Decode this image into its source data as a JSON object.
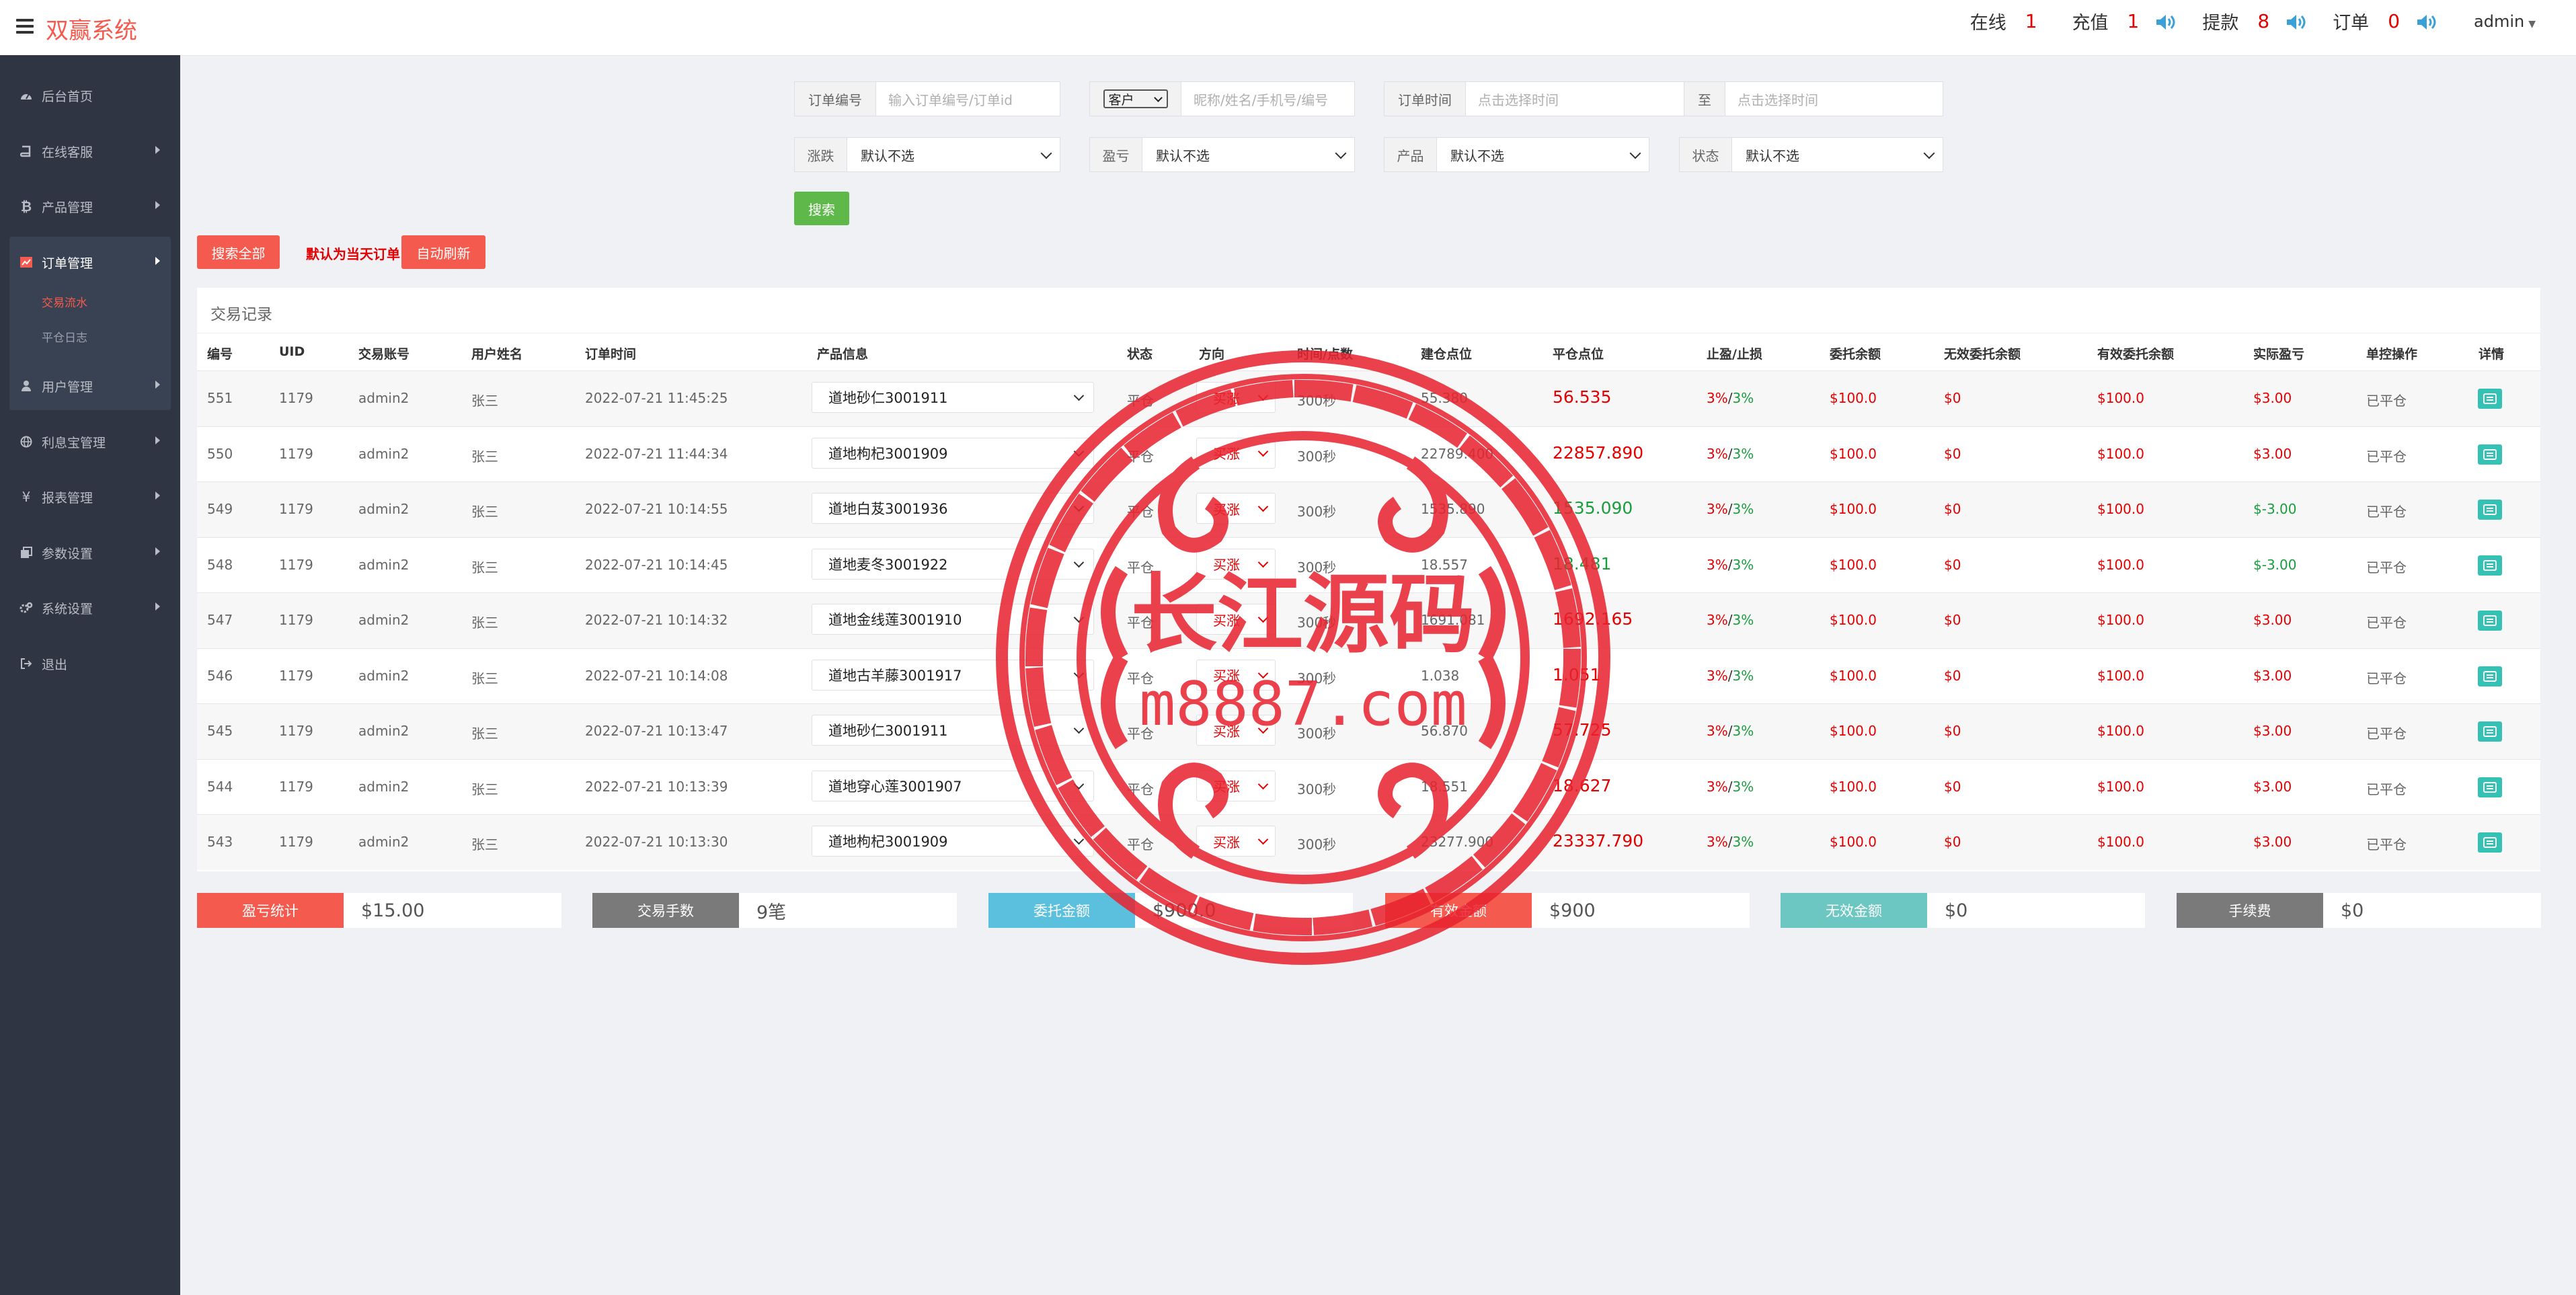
{
  "app": {
    "title": "双赢系统"
  },
  "topbar": {
    "online_label": "在线",
    "online_count": "1",
    "recharge_label": "充值",
    "recharge_count": "1",
    "withdraw_label": "提款",
    "withdraw_count": "8",
    "order_label": "订单",
    "order_count": "0",
    "user": "admin"
  },
  "sidebar": {
    "items": [
      {
        "label": "后台首页",
        "icon": "gauge-icon"
      },
      {
        "label": "在线客服",
        "icon": "book-icon"
      },
      {
        "label": "产品管理",
        "icon": "bitcoin-icon"
      },
      {
        "label": "订单管理",
        "icon": "chart-icon"
      },
      {
        "label": "用户管理",
        "icon": "user-icon"
      },
      {
        "label": "利息宝管理",
        "icon": "globe-icon"
      },
      {
        "label": "报表管理",
        "icon": "yen-icon"
      },
      {
        "label": "参数设置",
        "icon": "copy-icon"
      },
      {
        "label": "系统设置",
        "icon": "gears-icon"
      },
      {
        "label": "退出",
        "icon": "signout-icon"
      }
    ],
    "sub_items": [
      {
        "label": "交易流水"
      },
      {
        "label": "平仓日志"
      }
    ]
  },
  "filters": {
    "order_no_label": "订单编号",
    "order_no_placeholder": "输入订单编号/订单id",
    "customer_select": "客户",
    "customer_placeholder": "昵称/姓名/手机号/编号",
    "order_time_label": "订单时间",
    "time_start_placeholder": "点击选择时间",
    "to_label": "至",
    "time_end_placeholder": "点击选择时间",
    "rise_fall_label": "涨跌",
    "profit_label": "盈亏",
    "product_label": "产品",
    "status_label": "状态",
    "default_option": "默认不选",
    "search_button": "搜索"
  },
  "actions": {
    "search_all": "搜索全部",
    "default_hint": "默认为当天订单",
    "auto_refresh": "自动刷新"
  },
  "table": {
    "title": "交易记录",
    "headers": [
      "编号",
      "UID",
      "交易账号",
      "用户姓名",
      "订单时间",
      "产品信息",
      "状态",
      "方向",
      "时间/点数",
      "建仓点位",
      "平仓点位",
      "止盈/止损",
      "委托余额",
      "无效委托余额",
      "有效委托余额",
      "实际盈亏",
      "单控操作",
      "详情"
    ],
    "rows": [
      {
        "id": "551",
        "uid": "1179",
        "account": "admin2",
        "name": "张三",
        "time": "2022-07-21 11:45:25",
        "product": "道地砂仁3001911",
        "status": "平仓",
        "direction": "买涨",
        "duration": "300秒",
        "open": "55.380",
        "close": "56.535",
        "close_color": "red",
        "tp_sl": "3%/3%",
        "entrust": "$100.0",
        "invalid": "$0",
        "valid": "$100.0",
        "pnl": "$3.00",
        "pnl_color": "red",
        "control": "已平仓"
      },
      {
        "id": "550",
        "uid": "1179",
        "account": "admin2",
        "name": "张三",
        "time": "2022-07-21 11:44:34",
        "product": "道地枸杞3001909",
        "status": "平仓",
        "direction": "买涨",
        "duration": "300秒",
        "open": "22789.400",
        "close": "22857.890",
        "close_color": "red",
        "tp_sl": "3%/3%",
        "entrust": "$100.0",
        "invalid": "$0",
        "valid": "$100.0",
        "pnl": "$3.00",
        "pnl_color": "red",
        "control": "已平仓"
      },
      {
        "id": "549",
        "uid": "1179",
        "account": "admin2",
        "name": "张三",
        "time": "2022-07-21 10:14:55",
        "product": "道地白芨3001936",
        "status": "平仓",
        "direction": "买涨",
        "duration": "300秒",
        "open": "1535.890",
        "close": "1535.090",
        "close_color": "green",
        "tp_sl": "3%/3%",
        "entrust": "$100.0",
        "invalid": "$0",
        "valid": "$100.0",
        "pnl": "$-3.00",
        "pnl_color": "green",
        "control": "已平仓"
      },
      {
        "id": "548",
        "uid": "1179",
        "account": "admin2",
        "name": "张三",
        "time": "2022-07-21 10:14:45",
        "product": "道地麦冬3001922",
        "status": "平仓",
        "direction": "买涨",
        "duration": "300秒",
        "open": "18.557",
        "close": "18.481",
        "close_color": "green",
        "tp_sl": "3%/3%",
        "entrust": "$100.0",
        "invalid": "$0",
        "valid": "$100.0",
        "pnl": "$-3.00",
        "pnl_color": "green",
        "control": "已平仓"
      },
      {
        "id": "547",
        "uid": "1179",
        "account": "admin2",
        "name": "张三",
        "time": "2022-07-21 10:14:32",
        "product": "道地金线莲3001910",
        "status": "平仓",
        "direction": "买涨",
        "duration": "300秒",
        "open": "1691.081",
        "close": "1692.165",
        "close_color": "red",
        "tp_sl": "3%/3%",
        "entrust": "$100.0",
        "invalid": "$0",
        "valid": "$100.0",
        "pnl": "$3.00",
        "pnl_color": "red",
        "control": "已平仓"
      },
      {
        "id": "546",
        "uid": "1179",
        "account": "admin2",
        "name": "张三",
        "time": "2022-07-21 10:14:08",
        "product": "道地古羊藤3001917",
        "status": "平仓",
        "direction": "买涨",
        "duration": "300秒",
        "open": "1.038",
        "close": "1.051",
        "close_color": "red",
        "tp_sl": "3%/3%",
        "entrust": "$100.0",
        "invalid": "$0",
        "valid": "$100.0",
        "pnl": "$3.00",
        "pnl_color": "red",
        "control": "已平仓"
      },
      {
        "id": "545",
        "uid": "1179",
        "account": "admin2",
        "name": "张三",
        "time": "2022-07-21 10:13:47",
        "product": "道地砂仁3001911",
        "status": "平仓",
        "direction": "买涨",
        "duration": "300秒",
        "open": "56.870",
        "close": "57.725",
        "close_color": "red",
        "tp_sl": "3%/3%",
        "entrust": "$100.0",
        "invalid": "$0",
        "valid": "$100.0",
        "pnl": "$3.00",
        "pnl_color": "red",
        "control": "已平仓"
      },
      {
        "id": "544",
        "uid": "1179",
        "account": "admin2",
        "name": "张三",
        "time": "2022-07-21 10:13:39",
        "product": "道地穿心莲3001907",
        "status": "平仓",
        "direction": "买涨",
        "duration": "300秒",
        "open": "18.551",
        "close": "18.627",
        "close_color": "red",
        "tp_sl": "3%/3%",
        "entrust": "$100.0",
        "invalid": "$0",
        "valid": "$100.0",
        "pnl": "$3.00",
        "pnl_color": "red",
        "control": "已平仓"
      },
      {
        "id": "543",
        "uid": "1179",
        "account": "admin2",
        "name": "张三",
        "time": "2022-07-21 10:13:30",
        "product": "道地枸杞3001909",
        "status": "平仓",
        "direction": "买涨",
        "duration": "300秒",
        "open": "23277.900",
        "close": "23337.790",
        "close_color": "red",
        "tp_sl": "3%/3%",
        "entrust": "$100.0",
        "invalid": "$0",
        "valid": "$100.0",
        "pnl": "$3.00",
        "pnl_color": "red",
        "control": "已平仓"
      }
    ]
  },
  "stats": [
    {
      "label": "盈亏统计",
      "value": "$15.00",
      "color": "#f55a4e"
    },
    {
      "label": "交易手数",
      "value": "9笔",
      "color": "#7a7a7a"
    },
    {
      "label": "委托金额",
      "value": "$900.0",
      "color": "#5bc0de"
    },
    {
      "label": "有效金额",
      "value": "$900",
      "color": "#f55a4e"
    },
    {
      "label": "无效金额",
      "value": "$0",
      "color": "#6cc7c2"
    },
    {
      "label": "手续费",
      "value": "$0",
      "color": "#7a7a7a"
    }
  ],
  "watermark": {
    "title": "长江源码",
    "url": "m8887.com"
  },
  "colors": {
    "brand": "#f55a4e",
    "sidebar": "#2f3542",
    "up": "#e40000",
    "down": "#1a9d3e",
    "detail": "#35c2b4"
  }
}
